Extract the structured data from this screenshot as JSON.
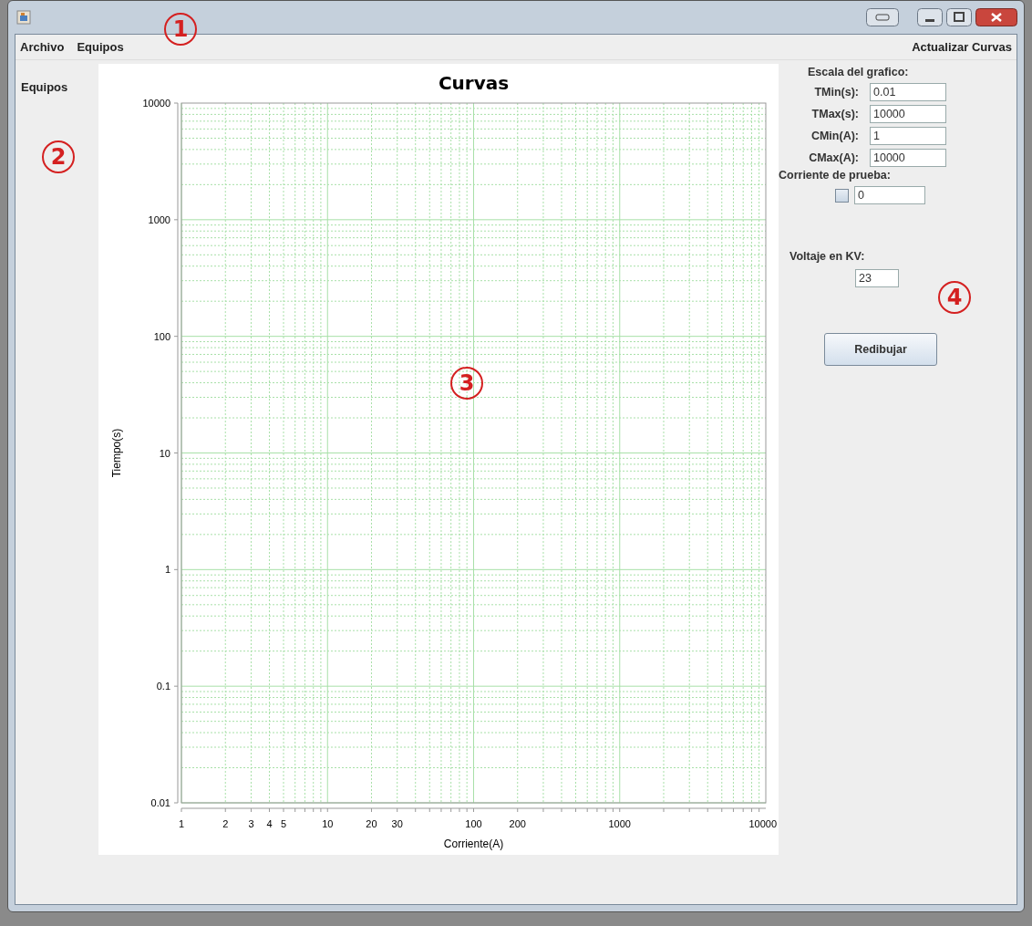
{
  "menu": {
    "items": [
      "Archivo",
      "Equipos"
    ],
    "right_item": "Actualizar Curvas"
  },
  "sidebar": {
    "title": "Equipos"
  },
  "chart": {
    "title": "Curvas",
    "x_axis_title": "Corriente(A)",
    "y_axis_title": "Tiempo(s)",
    "x_tick_labels": [
      "1",
      "2",
      "3",
      "4",
      "5",
      "10",
      "20",
      "30",
      "100",
      "200",
      "1000",
      "10000"
    ],
    "y_tick_labels": [
      "10000",
      "1000",
      "100",
      "10",
      "1",
      "0.1",
      "0.01"
    ]
  },
  "scale_panel": {
    "title": "Escala del grafico:",
    "fields": [
      {
        "label": "TMin(s):",
        "value": "0.01"
      },
      {
        "label": "TMax(s):",
        "value": "10000"
      },
      {
        "label": "CMin(A):",
        "value": "1"
      },
      {
        "label": "CMax(A):",
        "value": "10000"
      }
    ]
  },
  "test_current": {
    "label": "Corriente de prueba:",
    "checked": false,
    "value": "0"
  },
  "voltage": {
    "label": "Voltaje en KV:",
    "value": "23"
  },
  "redraw_button": "Redibujar",
  "annotations": [
    "1",
    "2",
    "3",
    "4"
  ]
}
